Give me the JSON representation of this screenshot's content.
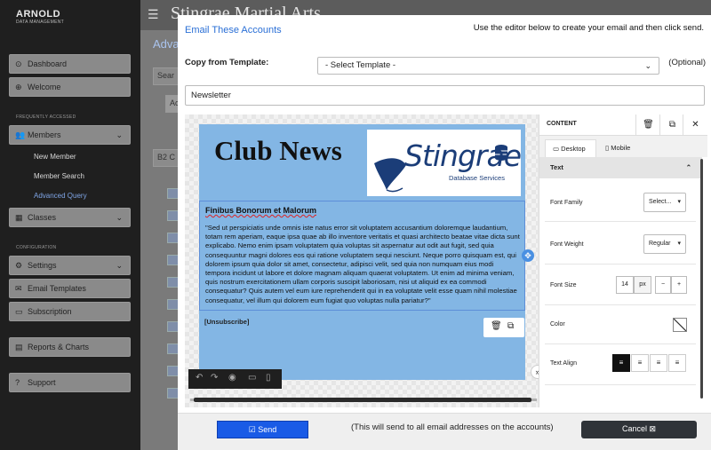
{
  "background": {
    "logo": "ARNOLD",
    "logo_sub": "DATA MANAGEMENT",
    "app_title": "Stingrae Martial Arts",
    "frag_adva": "Adva",
    "frag_search": "Sear",
    "frag_ac": "Ac",
    "frag_b2": "B2 C",
    "sidebar": {
      "dashboard": "Dashboard",
      "welcome": "Welcome",
      "section_frequent": "FREQUENTLY ACCESSED",
      "members": "Members",
      "new_member": "New Member",
      "member_search": "Member Search",
      "advanced_query": "Advanced Query",
      "classes": "Classes",
      "section_config": "CONFIGURATION",
      "settings": "Settings",
      "email_templates": "Email Templates",
      "subscription": "Subscription",
      "reports": "Reports & Charts",
      "support": "Support"
    }
  },
  "modal": {
    "title": "Email These Accounts",
    "instruction": "Use the editor below to create your email and then click send.",
    "copy_label": "Copy from Template:",
    "template_select": "- Select Template -",
    "optional": "(Optional)",
    "subject_value": "Newsletter",
    "send_label": "Send",
    "send_note": "(This will send to all email addresses on the accounts)",
    "cancel_label": "Cancel"
  },
  "email": {
    "heading": "Club News",
    "brand": "Stingrae",
    "brand_sub": "Database Services",
    "section_title": "Finibus Bonorum et Malorum",
    "body": "\"Sed ut perspiciatis unde omnis iste natus error sit voluptatem accusantium doloremque laudantium, totam rem aperiam, eaque ipsa quae ab illo inventore veritatis et quasi architecto beatae vitae dicta sunt explicabo. Nemo enim ipsam voluptatem quia voluptas sit aspernatur aut odit aut fugit, sed quia consequuntur magni dolores eos qui ratione voluptatem sequi nesciunt. Neque porro quisquam est, qui dolorem ipsum quia dolor sit amet, consectetur, adipisci velit, sed quia non numquam eius modi tempora incidunt ut labore et dolore magnam aliquam quaerat voluptatem. Ut enim ad minima veniam, quis nostrum exercitationem ullam corporis suscipit laboriosam, nisi ut aliquid ex ea commodi consequatur? Quis autem vel eum iure reprehenderit qui in ea voluptate velit esse quam nihil molestiae consequatur, vel illum qui dolorem eum fugiat quo voluptas nulla pariatur?\"",
    "unsubscribe": "[Unsubscribe]"
  },
  "panel": {
    "title": "CONTENT",
    "tab_desktop": "Desktop",
    "tab_mobile": "Mobile",
    "section": "Text",
    "font_family_label": "Font Family",
    "font_family_value": "Select...",
    "font_weight_label": "Font Weight",
    "font_weight_value": "Regular",
    "font_size_label": "Font Size",
    "font_size_value": "14",
    "font_size_unit": "px",
    "minus": "−",
    "plus": "+",
    "color_label": "Color",
    "align_label": "Text Align"
  },
  "icons": {
    "trash": "trash-icon",
    "copy": "copy-icon",
    "close": "close-icon",
    "drag": "move-icon",
    "expand": "double-chevron-right-icon",
    "undo": "undo-icon",
    "redo": "redo-icon",
    "preview": "eye-icon",
    "desktop": "desktop-icon",
    "mobile": "mobile-icon"
  },
  "colors": {
    "accent": "#2a6fd6",
    "send": "#1a5be6",
    "email_bg": "#83b6e4"
  }
}
